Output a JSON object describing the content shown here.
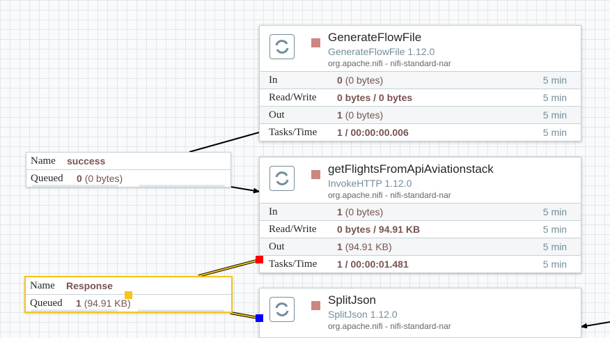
{
  "processors": [
    {
      "name": "GenerateFlowFile",
      "type": "GenerateFlowFile 1.12.0",
      "bundle": "org.apache.nifi - nifi-standard-nar",
      "stats": {
        "in_label": "In",
        "in_count": "0",
        "in_size": "(0 bytes)",
        "in_time": "5 min",
        "rw_label": "Read/Write",
        "rw_value": "0 bytes / 0 bytes",
        "rw_time": "5 min",
        "out_label": "Out",
        "out_count": "1",
        "out_size": "(0 bytes)",
        "out_time": "5 min",
        "tasks_label": "Tasks/Time",
        "tasks_value": "1 / 00:00:00.006",
        "tasks_time": "5 min"
      }
    },
    {
      "name": "getFlightsFromApiAviationstack",
      "type": "InvokeHTTP 1.12.0",
      "bundle": "org.apache.nifi - nifi-standard-nar",
      "stats": {
        "in_label": "In",
        "in_count": "1",
        "in_size": "(0 bytes)",
        "in_time": "5 min",
        "rw_label": "Read/Write",
        "rw_value": "0 bytes / 94.91 KB",
        "rw_time": "5 min",
        "out_label": "Out",
        "out_count": "1",
        "out_size": "(94.91 KB)",
        "out_time": "5 min",
        "tasks_label": "Tasks/Time",
        "tasks_value": "1 / 00:00:01.481",
        "tasks_time": "5 min"
      }
    },
    {
      "name": "SplitJson",
      "type": "SplitJson 1.12.0",
      "bundle": "org.apache.nifi - nifi-standard-nar"
    }
  ],
  "connections": [
    {
      "name_key": "Name",
      "name": "success",
      "queued_key": "Queued",
      "queued_count": "0",
      "queued_size": "(0 bytes)"
    },
    {
      "name_key": "Name",
      "name": "Response",
      "queued_key": "Queued",
      "queued_count": "1",
      "queued_size": "(94.91 KB)"
    }
  ],
  "icons": {
    "processor": "processor-icon",
    "state": "stopped-state-icon"
  },
  "colors": {
    "stopped": "#ce8680",
    "selected_border": "#f5c518",
    "handle_source": "#ff0000",
    "handle_target": "#0000ff"
  }
}
